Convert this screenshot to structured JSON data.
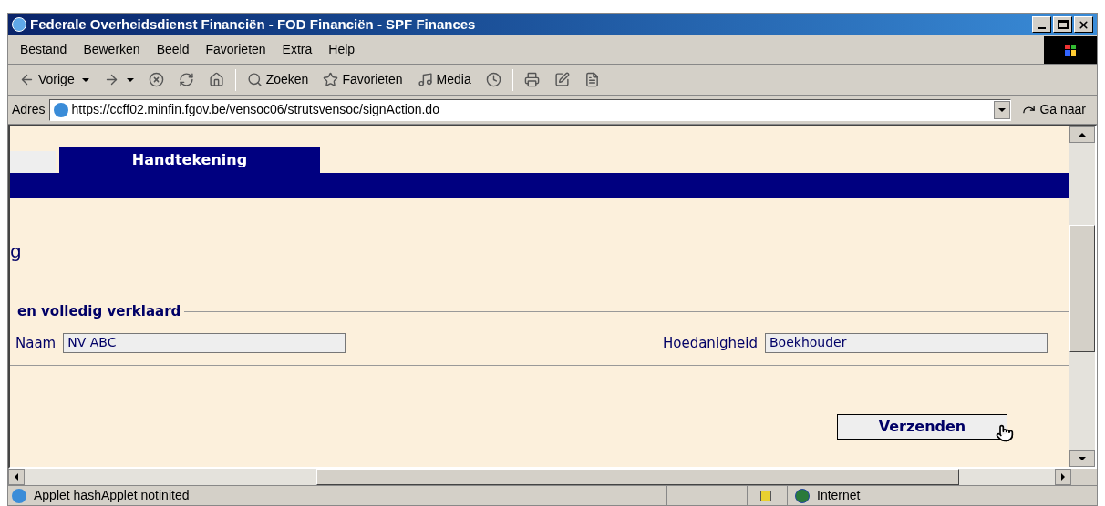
{
  "window": {
    "title": "Federale Overheidsdienst Financiën - FOD Financiën - SPF Finances"
  },
  "menu": [
    "Bestand",
    "Bewerken",
    "Beeld",
    "Favorieten",
    "Extra",
    "Help"
  ],
  "toolbar": [
    {
      "kind": "back",
      "label": "Vorige"
    },
    {
      "kind": "forward"
    },
    {
      "kind": "stop"
    },
    {
      "kind": "refresh"
    },
    {
      "kind": "home"
    },
    {
      "kind": "sep"
    },
    {
      "kind": "search",
      "label": "Zoeken"
    },
    {
      "kind": "favorites",
      "label": "Favorieten"
    },
    {
      "kind": "media",
      "label": "Media"
    },
    {
      "kind": "history"
    },
    {
      "kind": "sep"
    },
    {
      "kind": "print"
    },
    {
      "kind": "edit"
    },
    {
      "kind": "discuss"
    }
  ],
  "address": {
    "label": "Adres",
    "url": "https://ccff02.minfin.fgov.be/vensoc06/strutsvensoc/signAction.do",
    "go": "Ga naar"
  },
  "page": {
    "tab": "Handtekening",
    "heading": "g",
    "legend": "en volledig verklaard",
    "fields": [
      {
        "label": "Naam",
        "value": "NV ABC"
      },
      {
        "label": "Hoedanigheid",
        "value": "Boekhouder"
      }
    ],
    "submit": "Verzenden"
  },
  "status_bar": {
    "text": "Applet hashApplet notinited",
    "zone": "Internet"
  }
}
